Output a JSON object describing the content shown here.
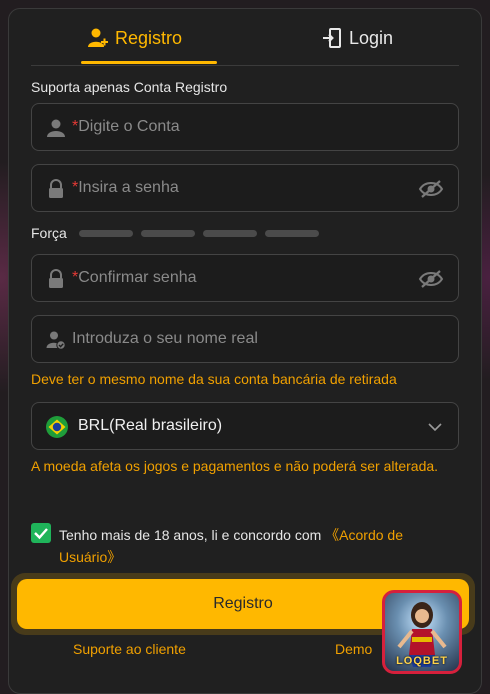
{
  "tabs": {
    "register": "Registro",
    "login": "Login"
  },
  "section_label": "Suporta apenas Conta Registro",
  "fields": {
    "account": {
      "required_mark": "*",
      "placeholder": "Digite o Conta"
    },
    "password": {
      "required_mark": "*",
      "placeholder": "Insira a senha"
    },
    "confirm": {
      "required_mark": "*",
      "placeholder": "Confirmar senha"
    },
    "real_name": {
      "placeholder": "Introduza o seu nome real"
    }
  },
  "strength_label": "Força",
  "real_name_hint": "Deve ter o mesmo nome da sua conta bancária de retirada",
  "currency": {
    "value": "BRL(Real brasileiro)"
  },
  "currency_hint": "A moeda afeta os jogos e pagamentos e não poderá ser alterada.",
  "agreement": {
    "text": "Tenho mais de 18 anos, li e concordo com ",
    "link": "《Acordo de Usuário》",
    "checked": true
  },
  "register_button": "Registro",
  "footer": {
    "support": "Suporte ao cliente",
    "demo": "Demo"
  },
  "app_icon": {
    "label": "LOQBET"
  },
  "colors": {
    "accent": "#ffb800",
    "required": "#e53935",
    "checkbox": "#1fb45a",
    "background": "#202020"
  }
}
